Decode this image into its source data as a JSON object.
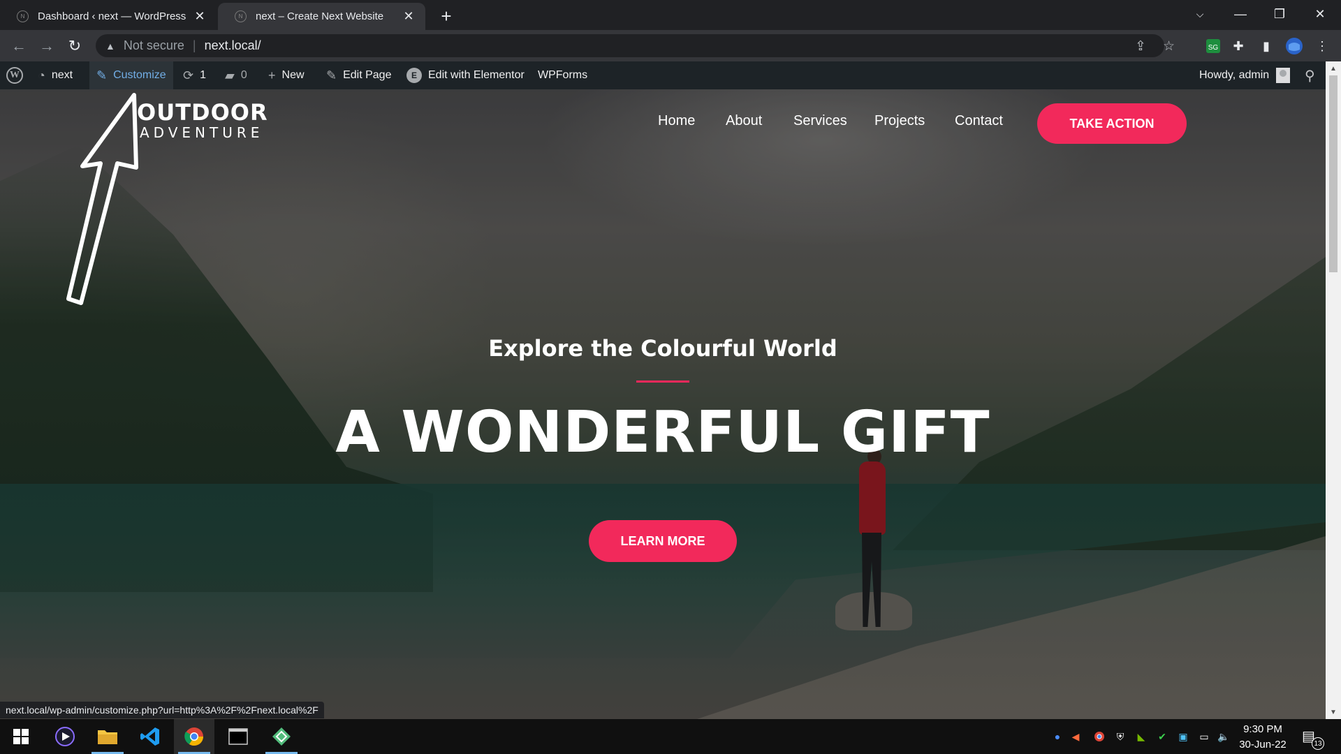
{
  "browser": {
    "tabs": [
      {
        "title": "Dashboard ‹ next — WordPress",
        "favicon": "N",
        "active": false
      },
      {
        "title": "next – Create Next Website",
        "favicon": "N",
        "active": true
      }
    ],
    "address": {
      "security": "Not secure",
      "url": "next.local/"
    },
    "status_url": "next.local/wp-admin/customize.php?url=http%3A%2F%2Fnext.local%2F"
  },
  "adminbar": {
    "site": "next",
    "customize": "Customize",
    "updates_count": "1",
    "comments_count": "0",
    "new": "New",
    "edit_page": "Edit Page",
    "edit_elementor": "Edit with Elementor",
    "elementor_glyph": "E",
    "wpforms": "WPForms",
    "howdy": "Howdy, admin"
  },
  "site": {
    "logo_top": "OUTDOOR",
    "logo_bottom": "ADVENTURE",
    "nav": [
      "Home",
      "About",
      "Services",
      "Projects",
      "Contact"
    ],
    "cta": "TAKE ACTION",
    "hero_subtitle": "Explore the Colourful World",
    "hero_title": "A WONDERFUL GIFT",
    "hero_button": "LEARN MORE"
  },
  "taskbar": {
    "time": "9:30 PM",
    "date": "30-Jun-22",
    "notifications": "13"
  },
  "colors": {
    "accent": "#f2295b",
    "adminbar": "#1d2327",
    "customize_link": "#72aee6"
  },
  "icons": {
    "annotation": "arrow-up-annotation"
  }
}
